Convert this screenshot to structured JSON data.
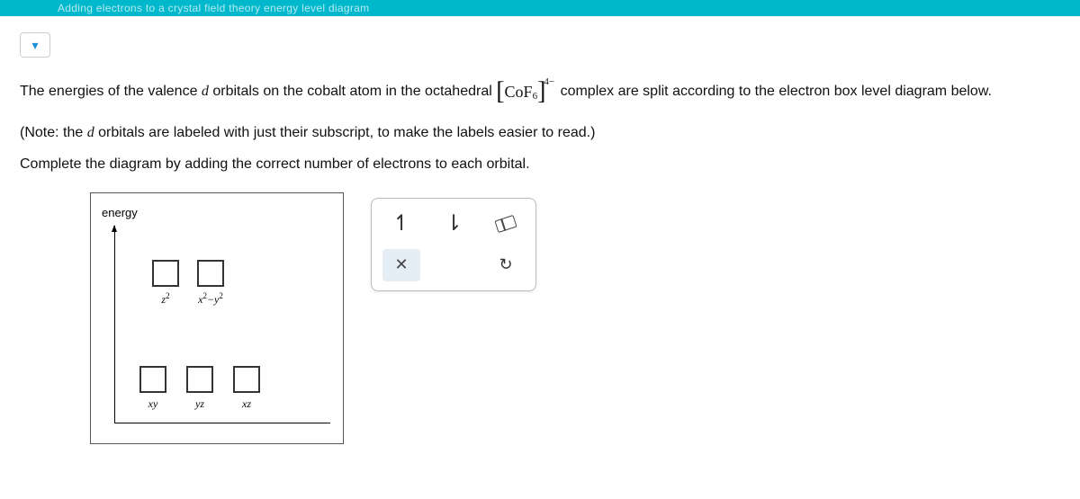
{
  "topbar": {
    "title": "Adding electrons to a crystal field theory energy level diagram"
  },
  "prompt": {
    "line1_a": "The energies of the valence ",
    "line1_b": " orbitals on the cobalt atom in the octahedral ",
    "line1_c": " complex are split according to the electron box level diagram below.",
    "d_letter": "d",
    "formula_core": "CoF",
    "formula_sub": "6",
    "formula_sup": "4−",
    "line2_a": "(Note: the ",
    "line2_b": " orbitals are labeled with just their subscript, to make the labels easier to read.)",
    "line3": "Complete the diagram by adding the correct number of electrons to each orbital."
  },
  "diagram": {
    "y_label": "energy",
    "upper": [
      {
        "label_html": "z",
        "sup1": "2"
      },
      {
        "label_html": "x",
        "sup1": "2",
        "mid": "−y",
        "sup2": "2"
      }
    ],
    "lower": [
      {
        "label": "xy"
      },
      {
        "label": "yz"
      },
      {
        "label": "xz"
      }
    ]
  },
  "tools": {
    "spin_up": "↿",
    "spin_down": "⇂",
    "clear": "✕",
    "undo": "↻"
  }
}
